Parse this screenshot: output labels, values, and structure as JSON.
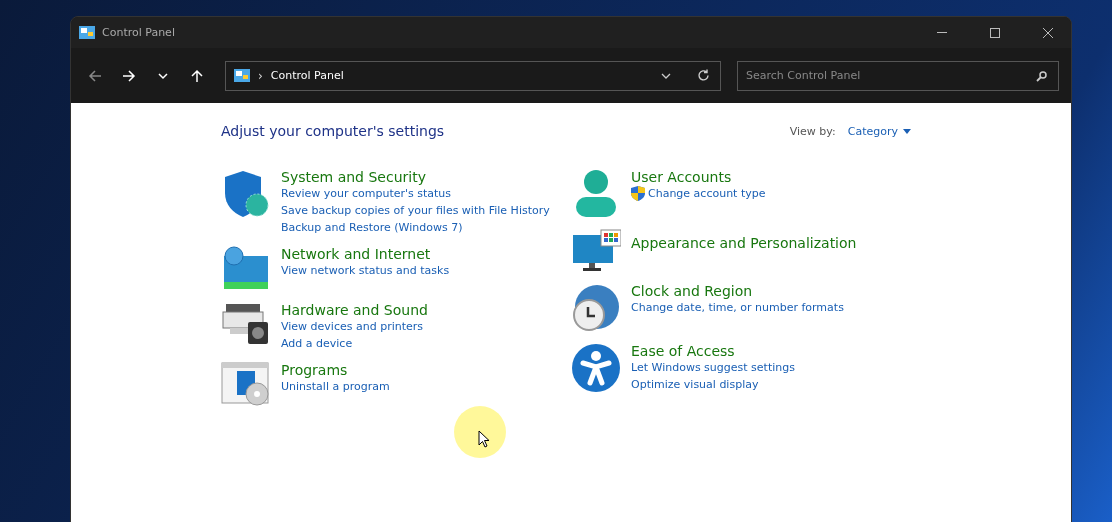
{
  "window": {
    "title": "Control Panel"
  },
  "nav_buttons": [
    {
      "kind": "back",
      "disabled": true
    },
    {
      "kind": "forward",
      "disabled": false
    },
    {
      "kind": "recent",
      "disabled": false
    },
    {
      "kind": "up",
      "disabled": false
    }
  ],
  "address_bar": {
    "separator": "›",
    "path": "Control Panel"
  },
  "search": {
    "placeholder": "Search Control Panel"
  },
  "heading": "Adjust your computer's settings",
  "view_by": {
    "label": "View by:",
    "value": "Category"
  },
  "columns": [
    [
      {
        "kind": "security",
        "title": "System and Security",
        "links": [
          {
            "text": "Review your computer's status",
            "kind": "plain"
          },
          {
            "text": "Save backup copies of your files with File History",
            "kind": "plain"
          },
          {
            "text": "Backup and Restore (Windows 7)",
            "kind": "plain"
          }
        ]
      },
      {
        "kind": "network",
        "title": "Network and Internet",
        "links": [
          {
            "text": "View network status and tasks",
            "kind": "plain"
          }
        ]
      },
      {
        "kind": "hardware",
        "title": "Hardware and Sound",
        "links": [
          {
            "text": "View devices and printers",
            "kind": "plain"
          },
          {
            "text": "Add a device",
            "kind": "plain"
          }
        ]
      },
      {
        "kind": "programs",
        "title": "Programs",
        "links": [
          {
            "text": "Uninstall a program",
            "kind": "plain"
          }
        ]
      }
    ],
    [
      {
        "kind": "user",
        "title": "User Accounts",
        "links": [
          {
            "text": "Change account type",
            "kind": "shield"
          }
        ]
      },
      {
        "kind": "appearance",
        "title": "Appearance and Personalization"
      },
      {
        "kind": "clock",
        "title": "Clock and Region",
        "links": [
          {
            "text": "Change date, time, or number formats",
            "kind": "plain"
          }
        ]
      },
      {
        "kind": "access",
        "title": "Ease of Access",
        "links": [
          {
            "text": "Let Windows suggest settings",
            "kind": "plain"
          },
          {
            "text": "Optimize visual display",
            "kind": "plain"
          }
        ]
      }
    ]
  ]
}
